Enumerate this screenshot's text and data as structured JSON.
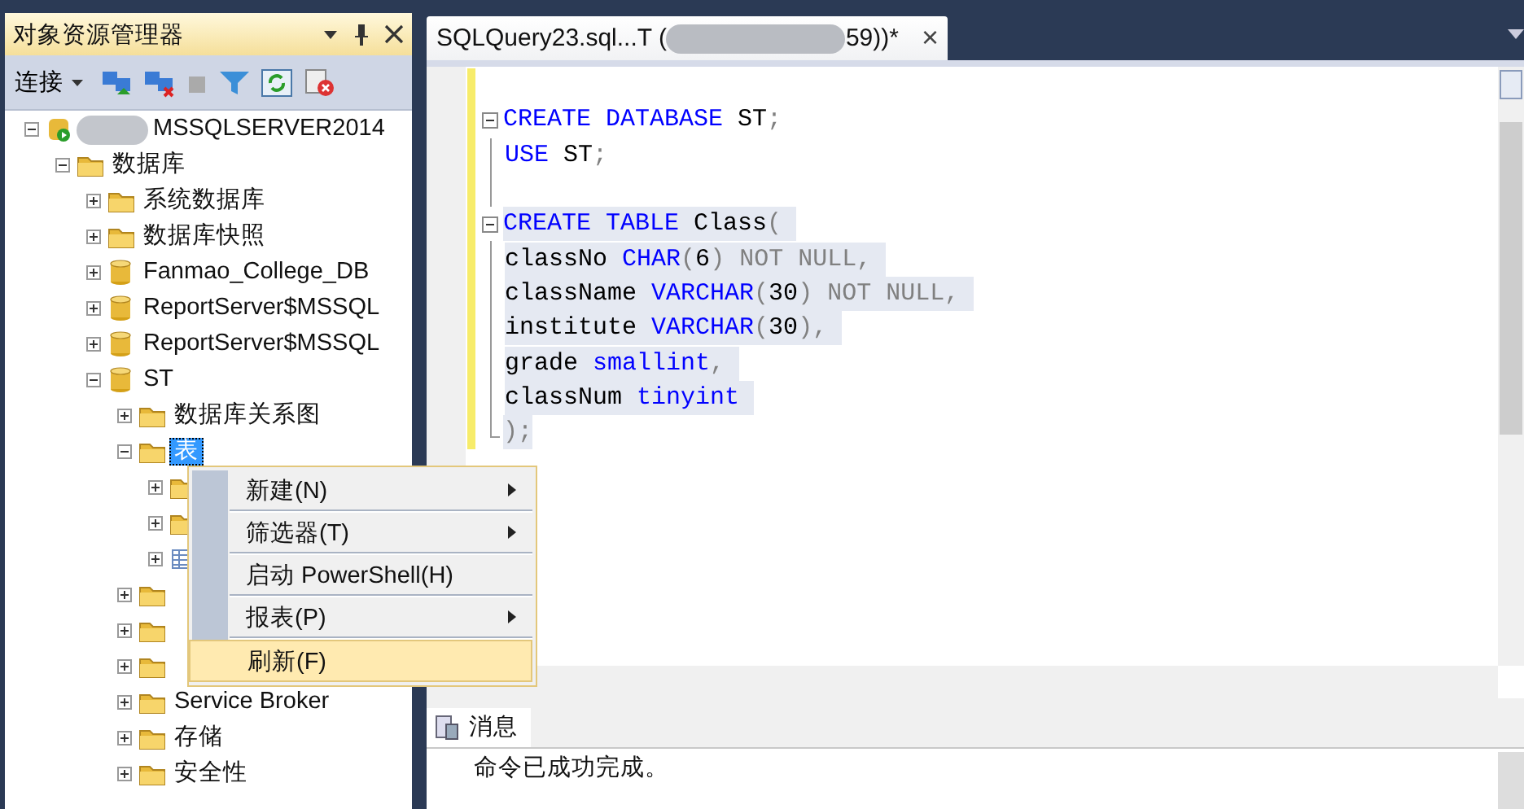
{
  "explorer": {
    "title": "对象资源管理器",
    "connect_label": "连接",
    "tree": [
      {
        "label": "MSSQLSERVER2014",
        "kind": "server",
        "expanded": true,
        "selected": false,
        "children": [
          {
            "label": "数据库",
            "kind": "folder",
            "expanded": true,
            "selected": false,
            "children": [
              {
                "label": "系统数据库",
                "kind": "folder",
                "expanded": false,
                "selected": false
              },
              {
                "label": "数据库快照",
                "kind": "folder",
                "expanded": false,
                "selected": false
              },
              {
                "label": "Fanmao_College_DB",
                "kind": "database",
                "expanded": false,
                "selected": false
              },
              {
                "label": "ReportServer$MSSQL",
                "kind": "database",
                "expanded": false,
                "selected": false
              },
              {
                "label": "ReportServer$MSSQL",
                "kind": "database",
                "expanded": false,
                "selected": false
              },
              {
                "label": "ST",
                "kind": "database",
                "expanded": true,
                "selected": false,
                "children": [
                  {
                    "label": "数据库关系图",
                    "kind": "folder",
                    "expanded": false,
                    "selected": false
                  },
                  {
                    "label": "表",
                    "kind": "folder",
                    "expanded": true,
                    "selected": true,
                    "children": [
                      {
                        "kind": "folder",
                        "expanded": false
                      },
                      {
                        "kind": "folder",
                        "expanded": false
                      },
                      {
                        "kind": "table",
                        "expanded": false
                      }
                    ]
                  },
                  {
                    "kind": "folder",
                    "expanded": false
                  },
                  {
                    "kind": "folder",
                    "expanded": false
                  },
                  {
                    "kind": "folder",
                    "expanded": false
                  },
                  {
                    "label": "Service Broker",
                    "kind": "folder",
                    "expanded": false,
                    "selected": false
                  },
                  {
                    "label": "存储",
                    "kind": "folder",
                    "expanded": false,
                    "selected": false
                  },
                  {
                    "label": "安全性",
                    "kind": "folder",
                    "expanded": false,
                    "selected": false
                  }
                ]
              }
            ]
          }
        ]
      }
    ]
  },
  "editor": {
    "tab": {
      "title_start": "SQLQuery23.sql...T (",
      "title_end": "59))*",
      "close": "×"
    },
    "lines": [
      {
        "kind": "none",
        "changed": true
      },
      {
        "kind": "start",
        "changed": true,
        "selected": false,
        "tokens": [
          {
            "text": "CREATE DATABASE",
            "kind": "keyword"
          },
          {
            "text": " ST",
            "kind": "plain"
          },
          {
            "text": ";",
            "kind": "operator"
          }
        ]
      },
      {
        "kind": "inside",
        "changed": true,
        "selected": false,
        "tokens": [
          {
            "text": "USE",
            "kind": "keyword"
          },
          {
            "text": " ST",
            "kind": "plain"
          },
          {
            "text": ";",
            "kind": "operator"
          }
        ]
      },
      {
        "kind": "inside",
        "changed": true
      },
      {
        "kind": "start",
        "changed": true,
        "selected": true,
        "tokens": [
          {
            "text": "CREATE TABLE",
            "kind": "keyword"
          },
          {
            "text": " Class",
            "kind": "plain"
          },
          {
            "text": "( ",
            "kind": "operator"
          }
        ]
      },
      {
        "kind": "inside",
        "changed": true,
        "selected": true,
        "tokens": [
          {
            "text": "classNo ",
            "kind": "plain"
          },
          {
            "text": "CHAR",
            "kind": "keyword"
          },
          {
            "text": "(",
            "kind": "operator"
          },
          {
            "text": "6",
            "kind": "plain"
          },
          {
            "text": ") NOT NULL, ",
            "kind": "operator"
          }
        ]
      },
      {
        "kind": "inside",
        "changed": true,
        "selected": true,
        "tokens": [
          {
            "text": "className ",
            "kind": "plain"
          },
          {
            "text": "VARCHAR",
            "kind": "keyword"
          },
          {
            "text": "(",
            "kind": "operator"
          },
          {
            "text": "30",
            "kind": "plain"
          },
          {
            "text": ") NOT NULL, ",
            "kind": "operator"
          }
        ]
      },
      {
        "kind": "inside",
        "changed": true,
        "selected": true,
        "tokens": [
          {
            "text": "institute ",
            "kind": "plain"
          },
          {
            "text": "VARCHAR",
            "kind": "keyword"
          },
          {
            "text": "(",
            "kind": "operator"
          },
          {
            "text": "30",
            "kind": "plain"
          },
          {
            "text": "), ",
            "kind": "operator"
          }
        ]
      },
      {
        "kind": "inside",
        "changed": true,
        "selected": true,
        "tokens": [
          {
            "text": "grade ",
            "kind": "plain"
          },
          {
            "text": "smallint",
            "kind": "keyword"
          },
          {
            "text": ", ",
            "kind": "operator"
          }
        ]
      },
      {
        "kind": "inside",
        "changed": true,
        "selected": true,
        "tokens": [
          {
            "text": "classNum ",
            "kind": "plain"
          },
          {
            "text": "tinyint ",
            "kind": "keyword"
          }
        ]
      },
      {
        "kind": "end",
        "changed": true,
        "selected": true,
        "tokens": [
          {
            "text": ");",
            "kind": "operator"
          }
        ]
      }
    ]
  },
  "results": {
    "tab": "消息",
    "message": "命令已成功完成。"
  },
  "context_menu": [
    {
      "label": "新建(N)",
      "submenu": true,
      "selected": false
    },
    {
      "label": "筛选器(T)",
      "submenu": true,
      "selected": false
    },
    {
      "label": "启动 PowerShell(H)",
      "submenu": false,
      "selected": false
    },
    {
      "label": "报表(P)",
      "submenu": true,
      "selected": false
    },
    {
      "label": "刷新(F)",
      "submenu": false,
      "selected": true
    }
  ]
}
